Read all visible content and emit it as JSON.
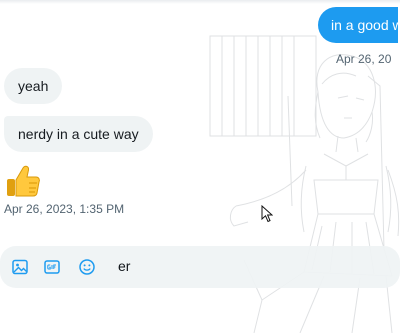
{
  "conversation": {
    "messages": [
      {
        "direction": "sent",
        "text": "in a good w"
      },
      {
        "direction": "sent_timestamp",
        "text": "Apr 26, 20"
      },
      {
        "direction": "received",
        "text": "yeah"
      },
      {
        "direction": "received",
        "text": "nerdy in a cute way"
      },
      {
        "direction": "received_emoji",
        "icon": "thumbs-up-icon"
      },
      {
        "direction": "received_timestamp",
        "text": "Apr 26, 2023, 1:35 PM"
      }
    ]
  },
  "composer": {
    "draft_text": "er",
    "tools": [
      "image-icon",
      "gif-icon",
      "emoji-icon"
    ]
  },
  "colors": {
    "sent_bubble": "#1d9bf0",
    "received_bubble": "#eff3f4",
    "timestamp": "#536471",
    "icon_accent": "#1d9bf0"
  }
}
